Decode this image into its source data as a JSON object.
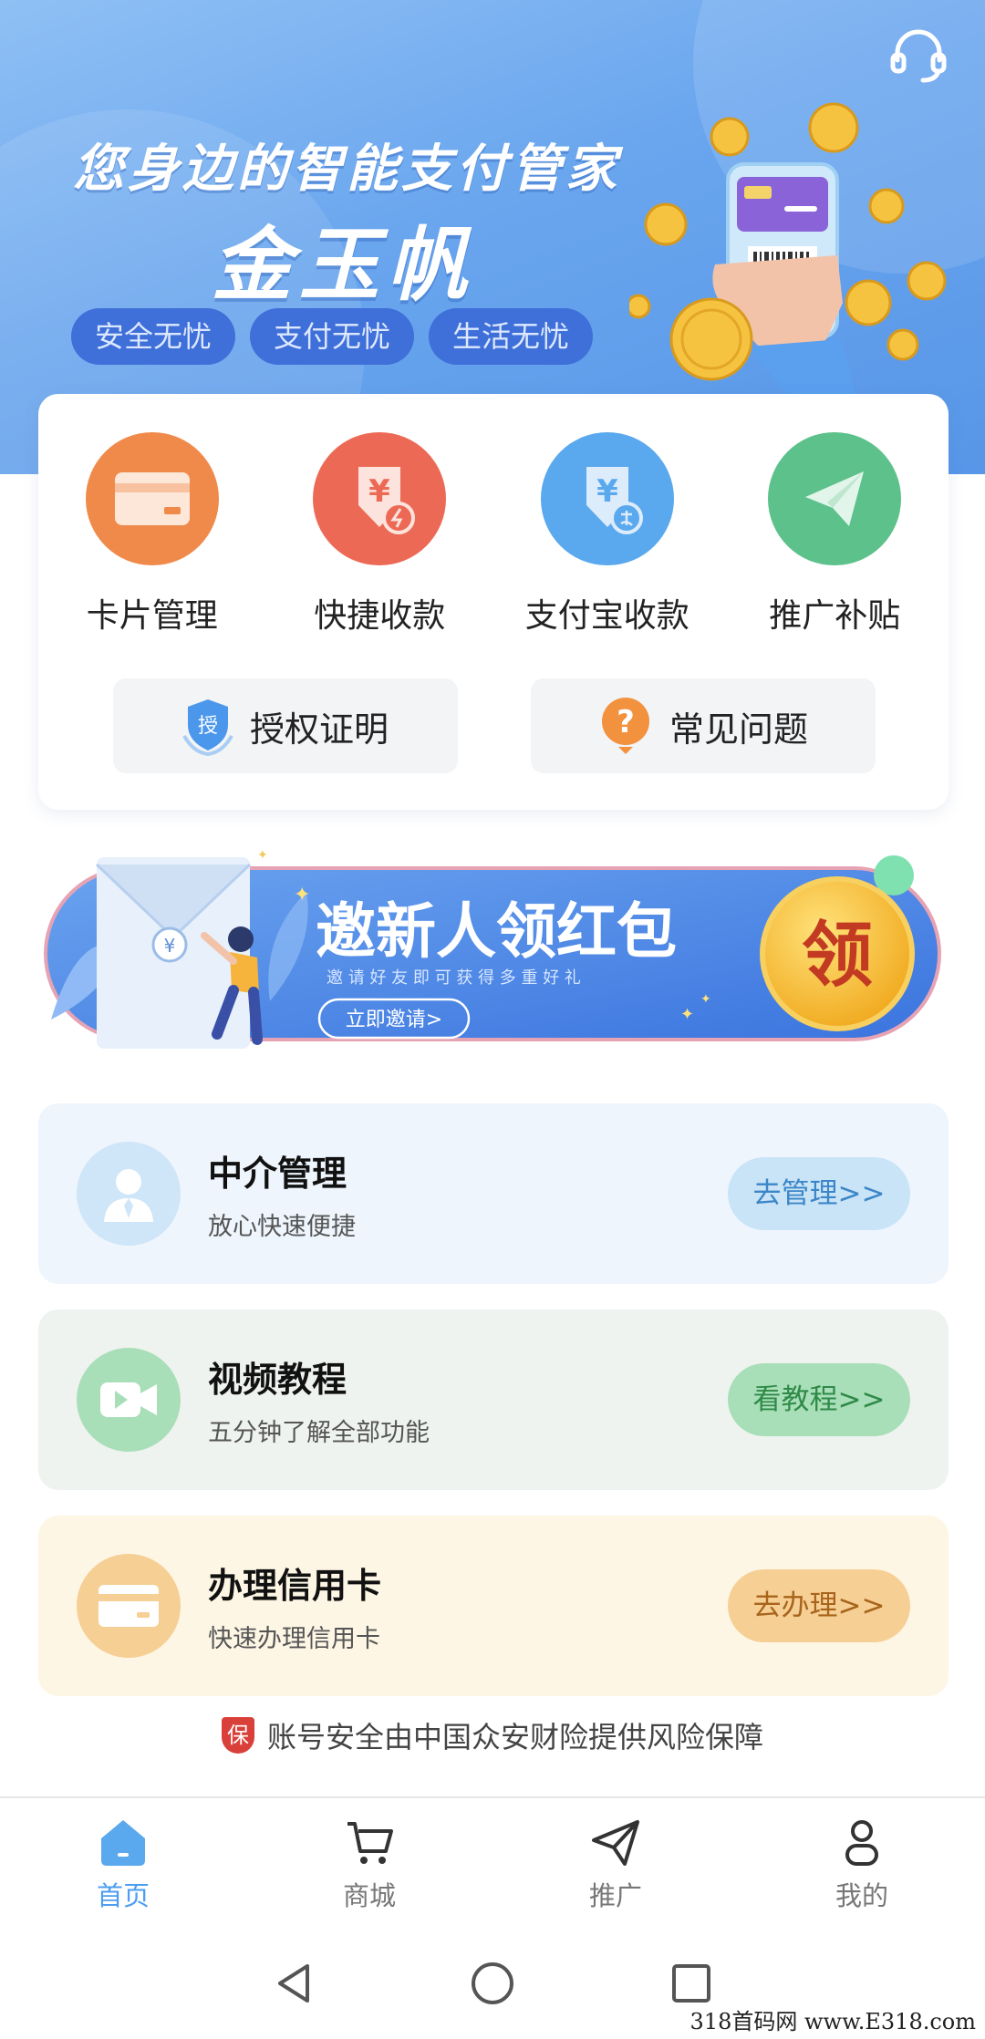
{
  "hero": {
    "slogan": "您身边的智能支付管家",
    "brand": "金玉帆",
    "tags": [
      "安全无忧",
      "支付无忧",
      "生活无忧"
    ]
  },
  "functions": [
    {
      "label": "卡片管理",
      "icon": "card-icon",
      "color": "#f08a4b"
    },
    {
      "label": "快捷收款",
      "icon": "yuan-receive-icon",
      "color": "#ec6a55"
    },
    {
      "label": "支付宝收款",
      "icon": "alipay-receive-icon",
      "color": "#5aa8ee"
    },
    {
      "label": "推广补贴",
      "icon": "paper-plane-icon",
      "color": "#5cc18a"
    }
  ],
  "sub_buttons": [
    {
      "label": "授权证明",
      "icon": "shield-icon"
    },
    {
      "label": "常见问题",
      "icon": "question-icon"
    }
  ],
  "invite": {
    "title": "邀新人领红包",
    "subtitle": "邀 请 好 友 即 可 获 得 多 重 好 礼",
    "button": "立即邀请>",
    "badge": "领",
    "envelope_symbol": "¥"
  },
  "features": [
    {
      "title": "中介管理",
      "subtitle": "放心快速便捷",
      "button": "去管理>>",
      "icon": "agent-icon",
      "bg": "#eef5fd",
      "icon_bg": "#cfe6f8",
      "btn_bg": "#c9e4f7",
      "btn_color": "#3c86c8"
    },
    {
      "title": "视频教程",
      "subtitle": "五分钟了解全部功能",
      "button": "看教程>>",
      "icon": "video-icon",
      "bg": "#eff3ef",
      "icon_bg": "#a9dfb8",
      "btn_bg": "#a9dfb8",
      "btn_color": "#2f8a48"
    },
    {
      "title": "办理信用卡",
      "subtitle": "快速办理信用卡",
      "button": "去办理>>",
      "icon": "credit-card-icon",
      "bg": "#fdf6e5",
      "icon_bg": "#f6cf95",
      "btn_bg": "#f6cf95",
      "btn_color": "#a8641b"
    }
  ],
  "insurance": {
    "badge": "保",
    "text": "账号安全由中国众安财险提供风险保障"
  },
  "tabs": [
    {
      "label": "首页",
      "icon": "home-icon",
      "active": true
    },
    {
      "label": "商城",
      "icon": "cart-icon",
      "active": false
    },
    {
      "label": "推广",
      "icon": "send-icon",
      "active": false
    },
    {
      "label": "我的",
      "icon": "user-icon",
      "active": false
    }
  ],
  "watermark": "318首码网  www.E318.com"
}
